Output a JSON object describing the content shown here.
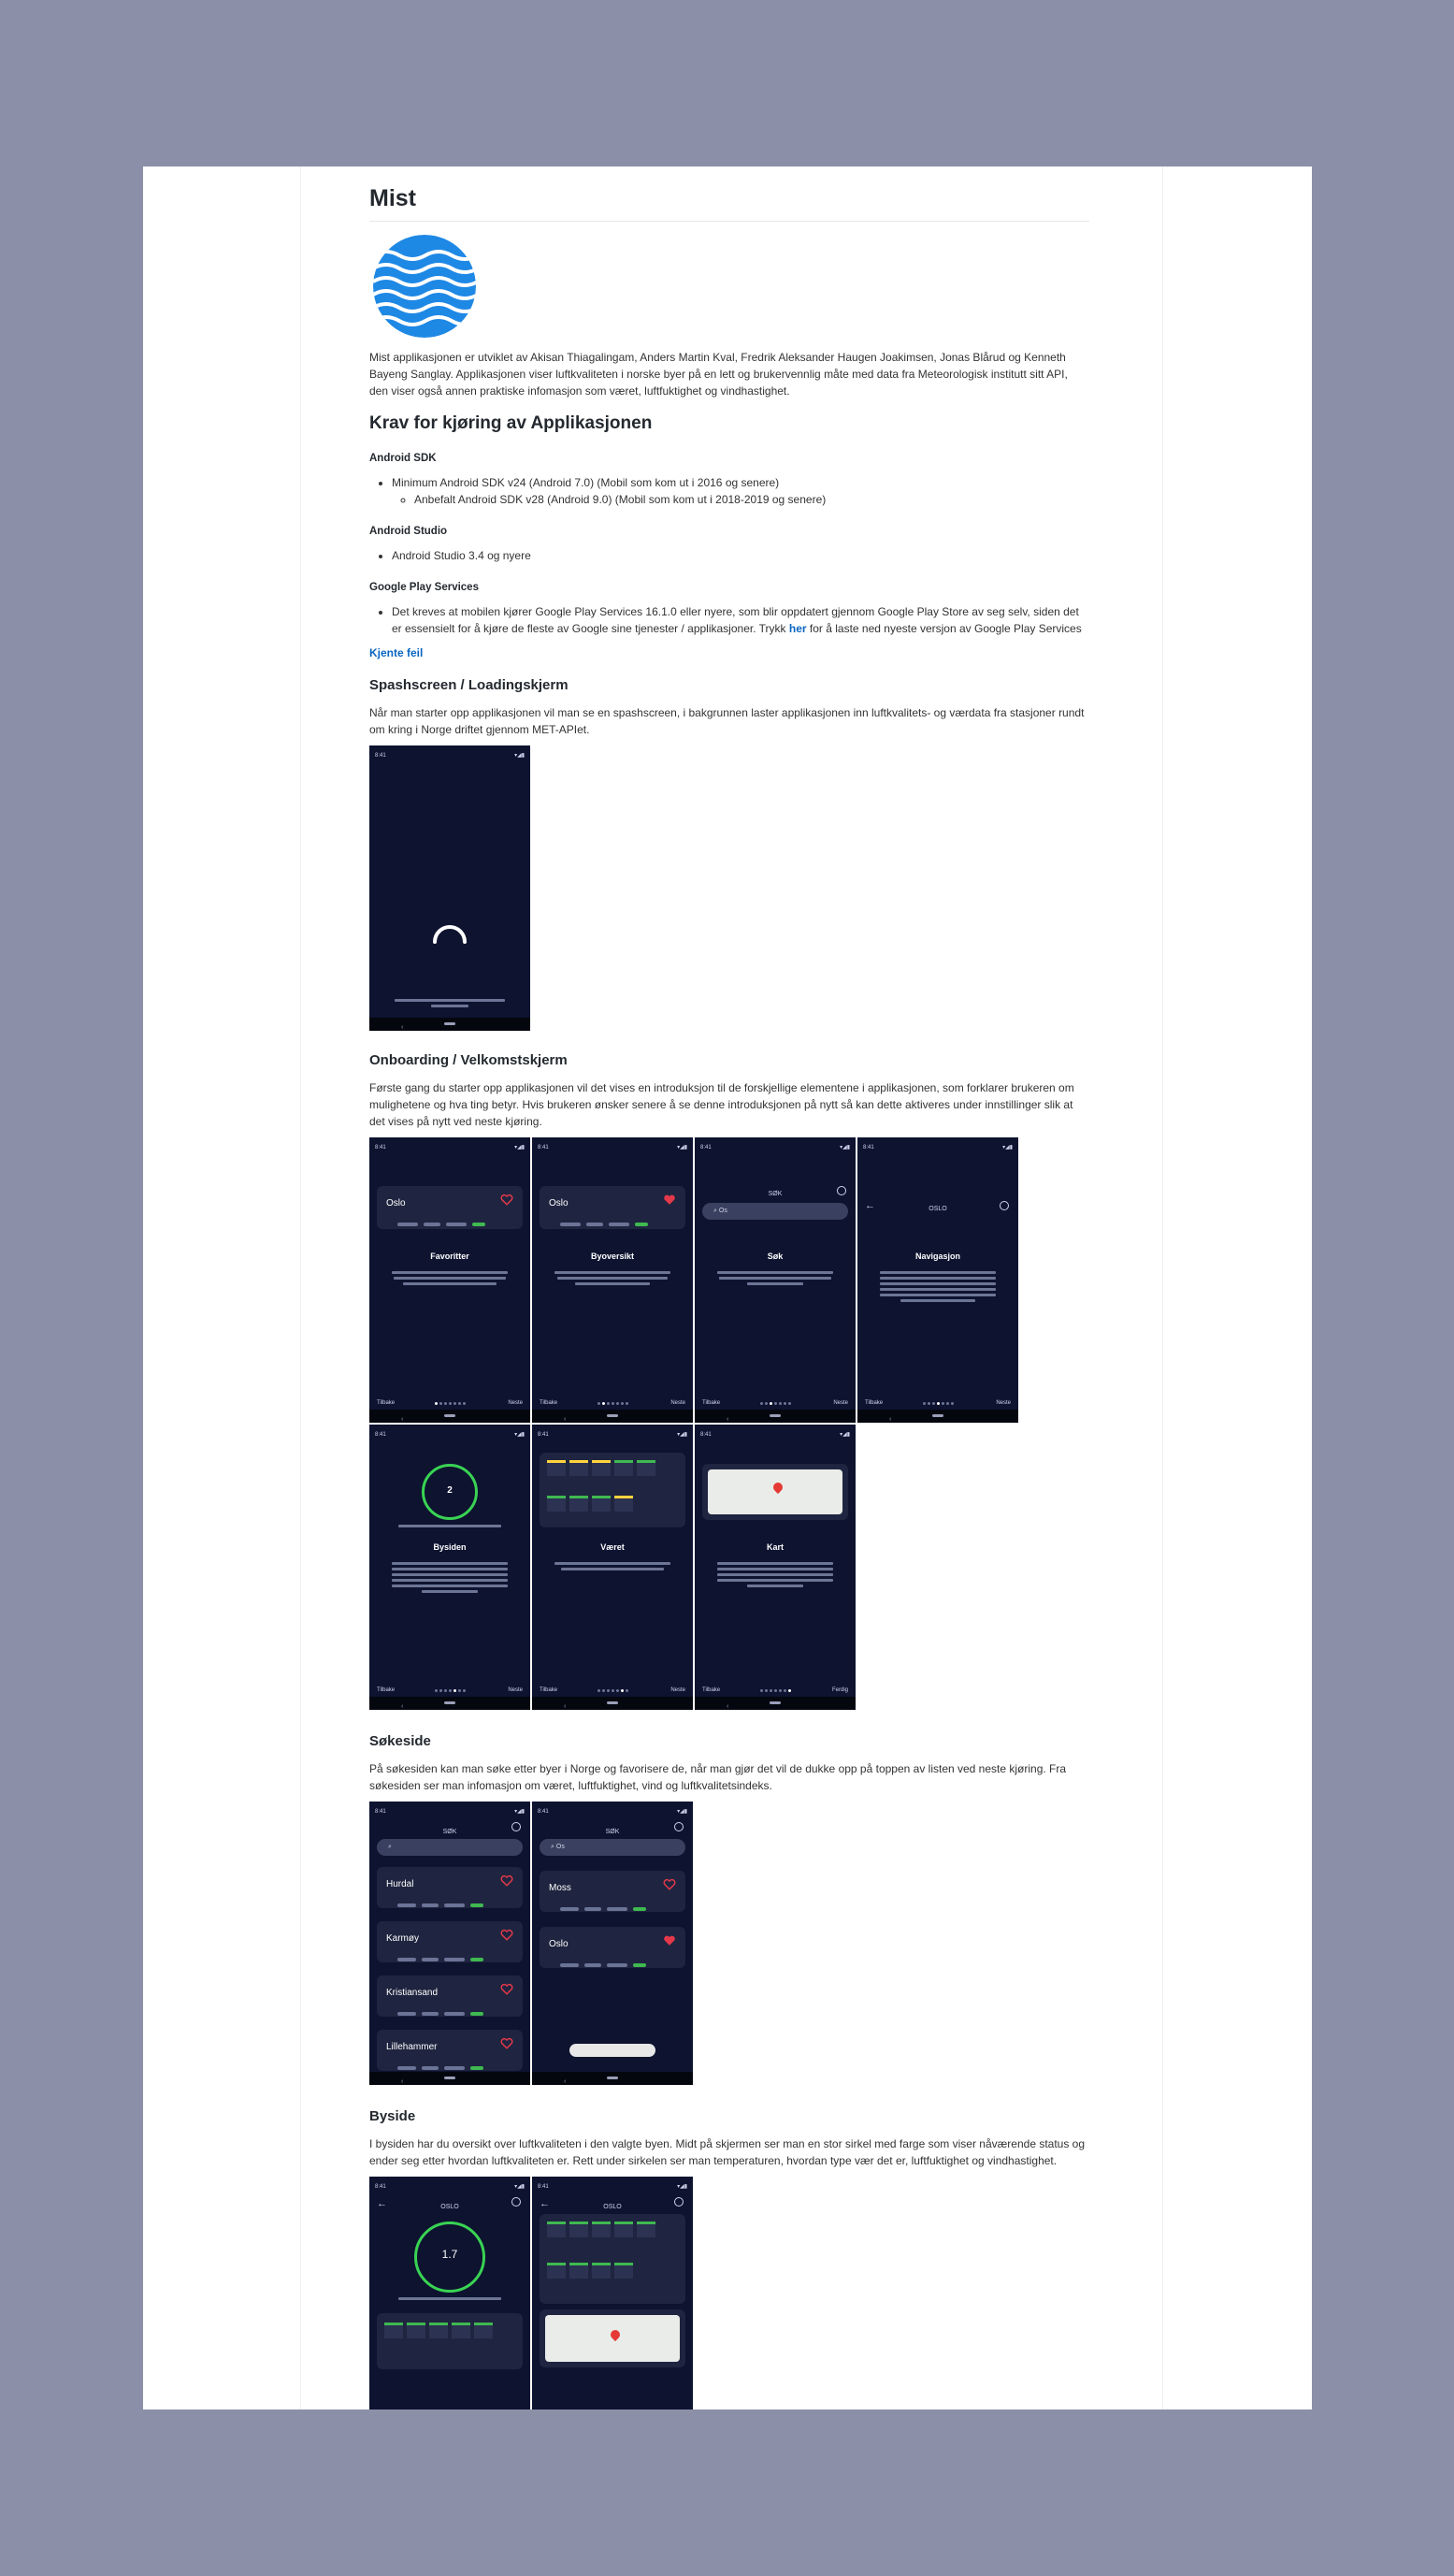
{
  "page": {
    "title": "Mist",
    "intro": "Mist applikasjonen er utviklet av Akisan Thiagalingam, Anders Martin Kval, Fredrik Aleksander Haugen Joakimsen, Jonas Blårud og Kenneth Bayeng Sanglay. Applikasjonen viser luftkvaliteten i norske byer på en lett og brukervennlig måte med data fra Meteorologisk institutt sitt API, den viser også annen praktiske infomasjon som været, luftfuktighet og vindhastighet.",
    "requirements_heading": "Krav for kjøring av Applikasjonen",
    "android_sdk": {
      "heading": "Android SDK",
      "item": "Minimum Android SDK v24 (Android 7.0) (Mobil som kom ut i 2016 og senere)",
      "subitem": "Anbefalt Android SDK v28 (Android 9.0) (Mobil som kom ut i 2018-2019 og senere)"
    },
    "android_studio": {
      "heading": "Android Studio",
      "item": "Android Studio 3.4 og nyere"
    },
    "play_services": {
      "heading": "Google Play Services",
      "text_before": "Det kreves at mobilen kjører Google Play Services 16.1.0 eller nyere, som blir oppdatert gjennom Google Play Store av seg selv, siden det er essensielt for å kjøre de fleste av Google sine tjenester / applikasjoner. Trykk ",
      "link": "her",
      "text_after": " for å laste ned nyeste versjon av Google Play Services"
    },
    "known_bugs_link": "Kjente feil",
    "splash": {
      "heading": "Spashscreen / Loadingskjerm",
      "text": "Når man starter opp applikasjonen vil man se en spashscreen, i bakgrunnen laster applikasjonen inn luftkvalitets- og værdata fra stasjoner rundt om kring i Norge driftet gjennom MET-APIet."
    },
    "onboarding": {
      "heading": "Onboarding / Velkomstskjerm",
      "text": "Første gang du starter opp applikasjonen vil det vises en introduksjon til de forskjellige elementene i applikasjonen, som forklarer brukeren om mulighetene og hva ting betyr. Hvis brukeren ønsker senere å se denne introduksjonen på nytt så kan dette aktiveres under innstillinger slik at det vises på nytt ved neste kjøring."
    },
    "search_page": {
      "heading": "Søkeside",
      "text": "På søkesiden kan man søke etter byer i Norge og favorisere de, når man gjør det vil de dukke opp på toppen av listen ved neste kjøring. Fra søkesiden ser man infomasjon om været, luftfuktighet, vind og luftkvalitetsindeks."
    },
    "city_page": {
      "heading": "Byside",
      "text": "I bysiden har du oversikt over luftkvaliteten i den valgte byen. Midt på skjermen ser man en stor sirkel med farge som viser nåværende status og ender seg etter hvordan luftkvaliteten er. Rett under sirkelen ser man temperaturen, hvordan type vær det er, luftfuktighet og vindhastighet."
    }
  },
  "screens": {
    "status_time": "8:41",
    "onboarding": [
      {
        "title": "Favoritter",
        "city": "Oslo",
        "left": "Tilbake",
        "right": "Neste"
      },
      {
        "title": "Byoversikt",
        "city": "Oslo",
        "left": "Tilbake",
        "right": "Neste"
      },
      {
        "title": "Søk",
        "header": "SØK",
        "search": "Os",
        "left": "Tilbake",
        "right": "Neste"
      },
      {
        "title": "Navigasjon",
        "header": "OSLO",
        "left": "Tilbake",
        "right": "Neste"
      },
      {
        "title": "Bysiden",
        "left": "Tilbake",
        "right": "Neste",
        "value": "2"
      },
      {
        "title": "Været",
        "left": "Tilbake",
        "right": "Neste"
      },
      {
        "title": "Kart",
        "left": "Tilbake",
        "right": "Ferdig"
      }
    ],
    "search_a": {
      "header": "SØK",
      "cities": [
        "Hurdal",
        "Karmøy",
        "Kristiansand",
        "Lillehammer"
      ]
    },
    "search_b": {
      "header": "SØK",
      "query": "Os",
      "cities": [
        "Moss",
        "Oslo"
      ]
    },
    "city_a": {
      "header": "OSLO",
      "value": "1.7"
    },
    "city_b": {
      "header": "OSLO"
    }
  },
  "colors": {
    "background": "#8b90a8",
    "screen": "#0e1330",
    "link": "#0a66c2",
    "good": "#3fb950",
    "heart": "#e5384a",
    "logo": "#1e88e5"
  }
}
